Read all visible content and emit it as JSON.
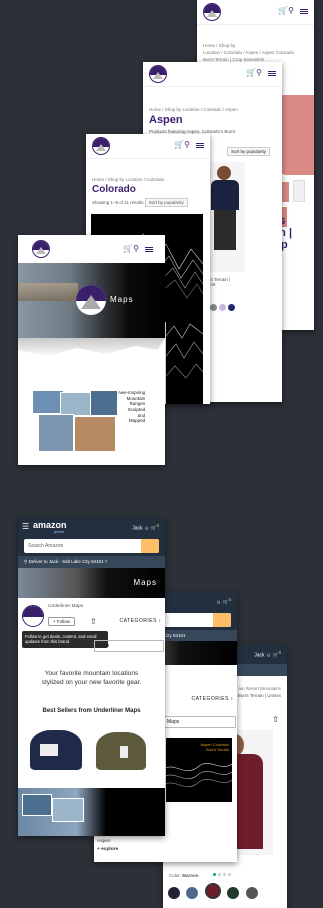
{
  "cards": {
    "aspen_product": {
      "breadcrumb_1": "Home / Shop by",
      "breadcrumb_2": "Location / Colorado / Aspen / Aspen Colorado",
      "breadcrumb_3": "Burnt Terrain | Crop Sweatshirt",
      "title_fragment_1": "o's",
      "title_fragment_2": "ain |",
      "title_fragment_3": "rop"
    },
    "aspen_category": {
      "breadcrumb": "Home / Shop by Location / Colorado / Aspen",
      "title": "Aspen",
      "intro_1": "Products featuring Aspen, Colorado's Burnt",
      "intro_2": "Terrain Peaks.",
      "sort": "Sort by popularity",
      "product_caption_1": "ain Terrain |",
      "product_caption_2": "shirt"
    },
    "colorado_category": {
      "breadcrumb": "Home / Shop by Location / Colorado",
      "title": "Colorado",
      "result_count": "Showing 1–9 of 11 results",
      "sort": "Sort by popularity"
    },
    "home": {
      "brand_text": "Maps",
      "collage_caption_1": "Awe-Inspiring",
      "collage_caption_2": "Mountain",
      "collage_caption_3": "Ranges",
      "collage_caption_4": "Sculpted",
      "collage_caption_5": "and",
      "collage_caption_6": "Mapped"
    },
    "amazon_store": {
      "logo": "amazon",
      "prime": "prime",
      "account": "Jack",
      "search_placeholder": "Search Amazon",
      "deliver_to": "Deliver to Jack - Salt Lake City 84101",
      "store_name": "Underliner Maps",
      "follow": "+ Follow",
      "categories": "CATEGORIES",
      "tooltip": "Follow to get deals, content, and email updates from this brand.",
      "tagline_1": "Your favorite mountain locations",
      "tagline_2": "stylized on your new favorite gear.",
      "best_sellers": "Best Sellers from Underliner Maps",
      "brand_text": "Maps",
      "footer_1": "Aspen",
      "footer_2": "+ explore",
      "search_fragment": "Maps",
      "cart_count": "0"
    },
    "amazon_category": {
      "deliver_fragment": "City 84101",
      "categories": "CATEGORIES",
      "search_fragment": "Maps",
      "art_caption_1": "Aspen Colorado",
      "art_caption_2": "Burnt Terrain",
      "cart_count": "0"
    },
    "amazon_product": {
      "header_fragment": "Jack",
      "deliver_fragment": "",
      "crumb": "ain Resort Mountains",
      "title_fragment": "n Burnt Terrain | Unisex",
      "color_label": "Color:",
      "color_value": "Maroon",
      "cart_count": "0"
    }
  },
  "colors": {
    "background": "#2c3138",
    "brand_purple": "#3a1f6b",
    "amazon_navy": "#232f3e",
    "amazon_orange": "#febd69",
    "maroon": "#6e1d2a",
    "pink_sweatshirt": "#d98a85"
  },
  "icons": [
    "cart-icon",
    "search-icon",
    "menu-icon",
    "account-icon",
    "share-icon",
    "location-icon"
  ]
}
